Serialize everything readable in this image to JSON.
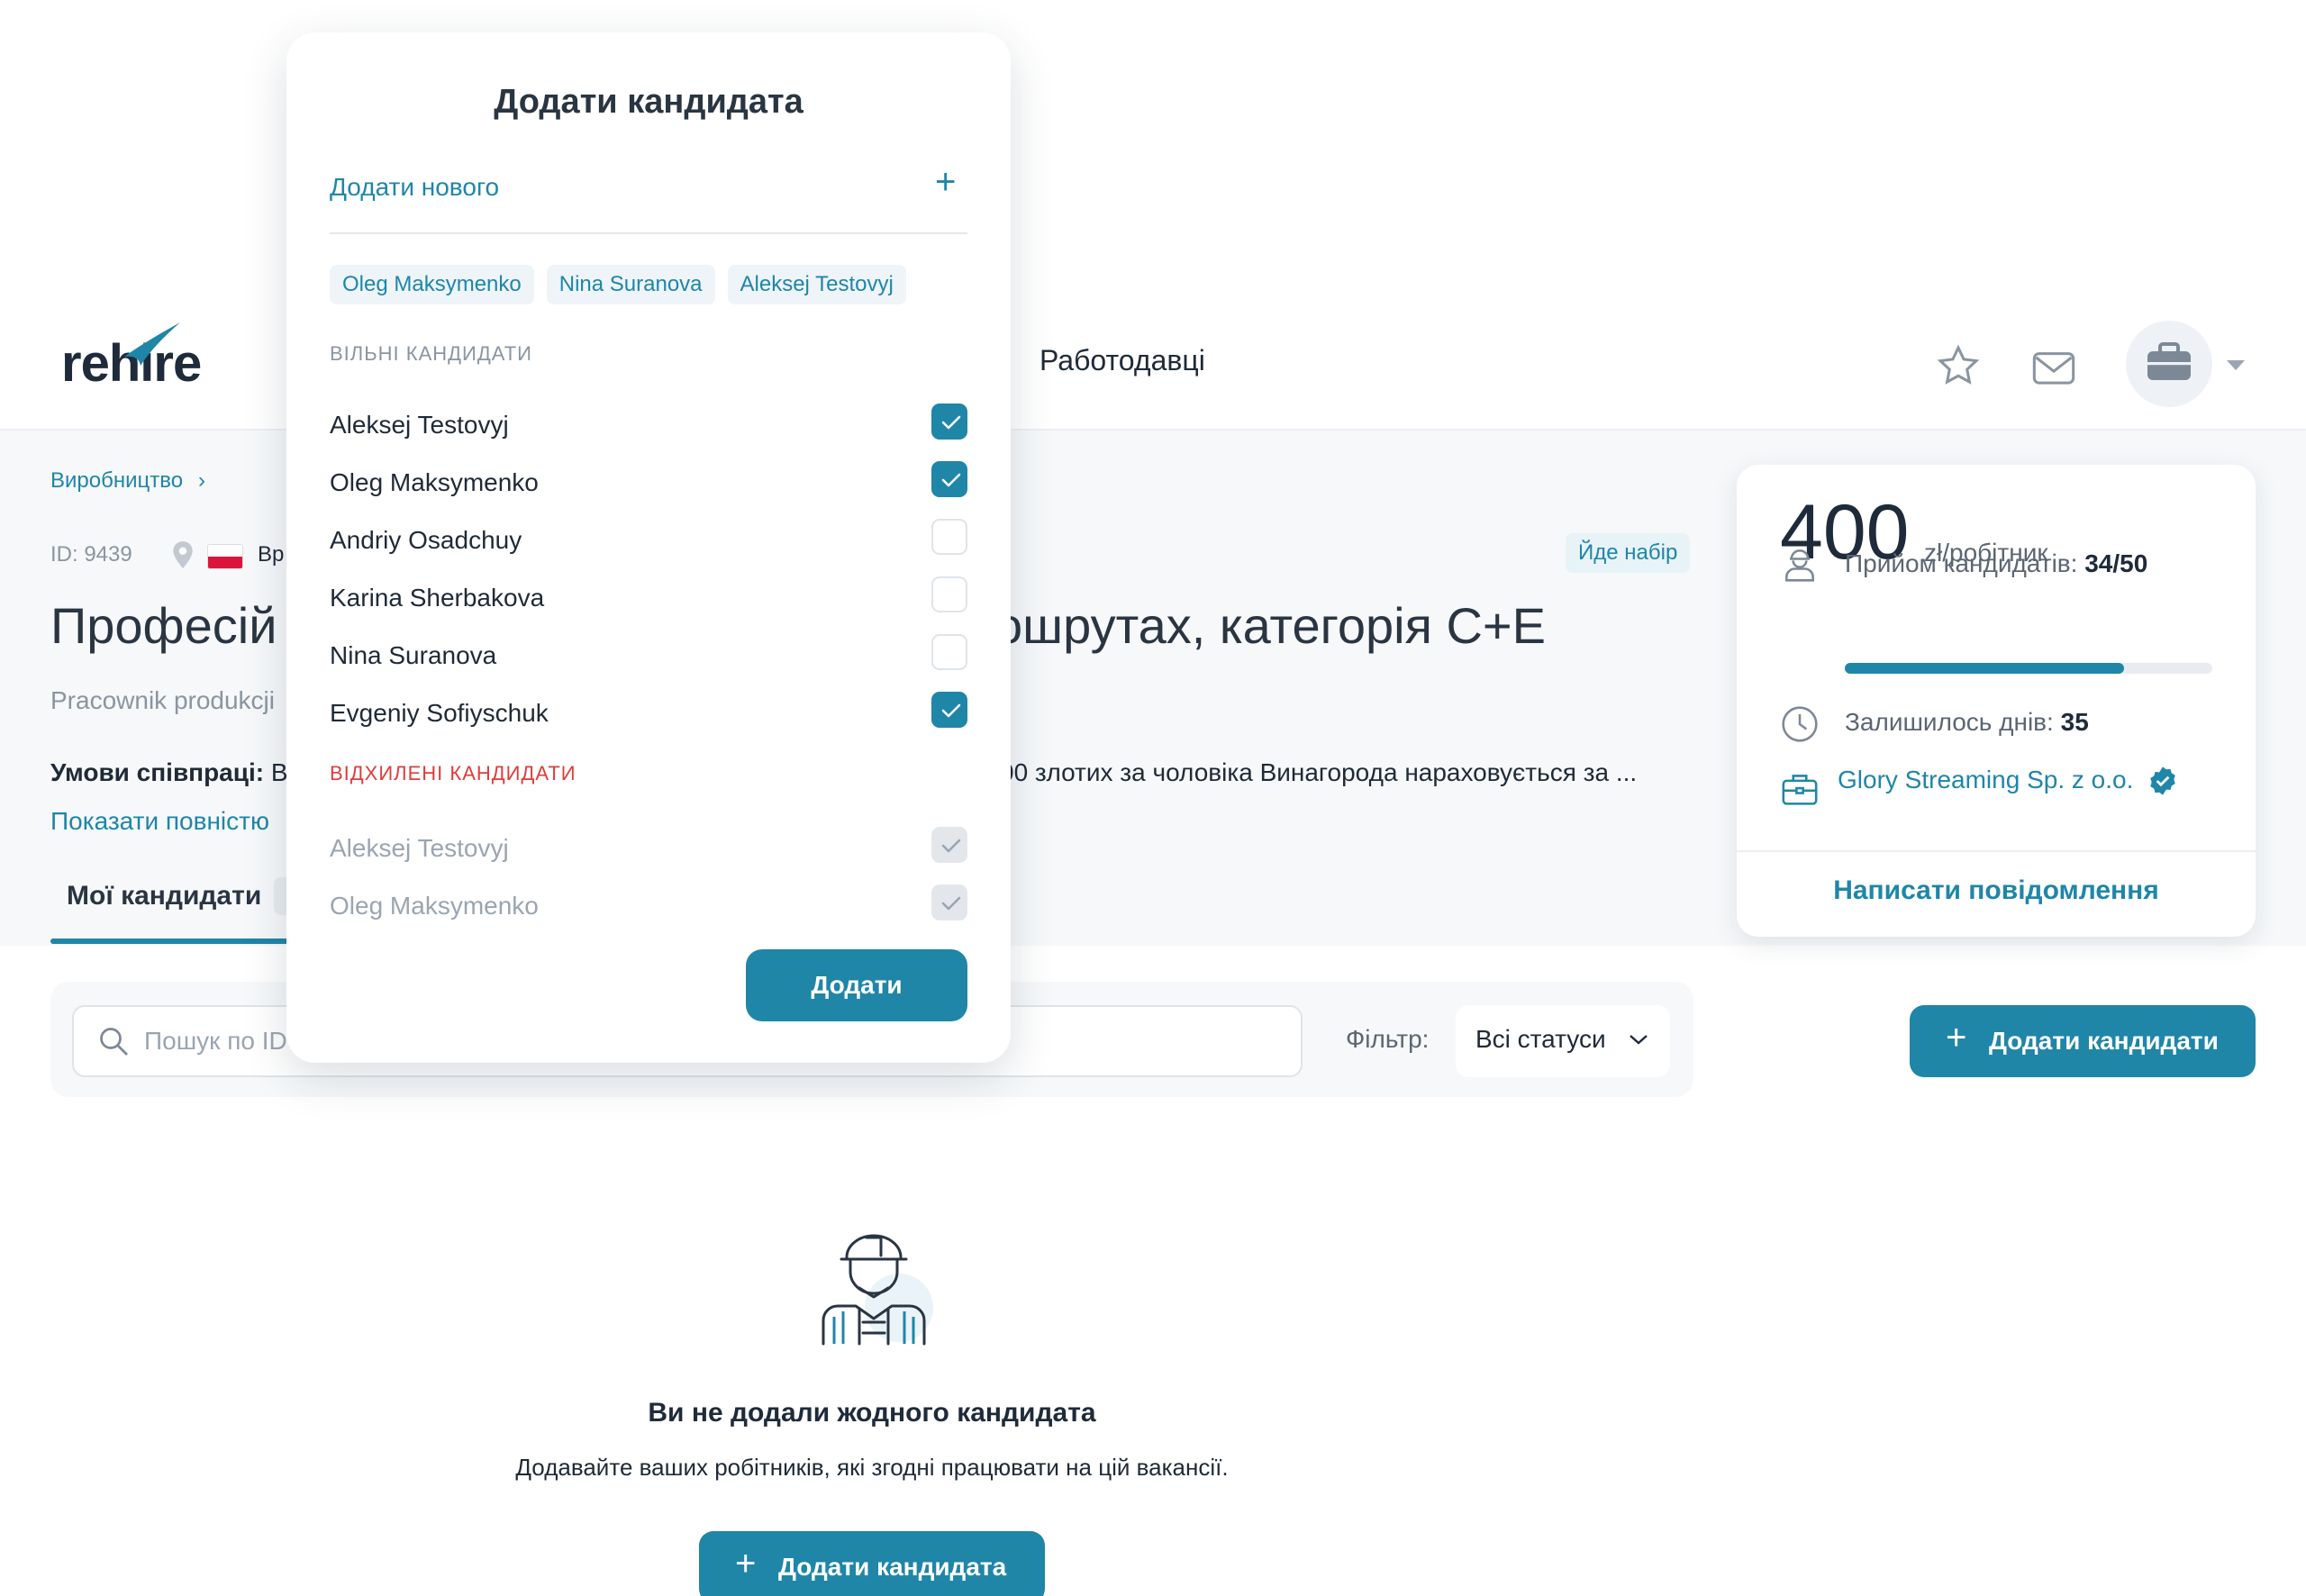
{
  "header": {
    "logo": "rehire",
    "nav_employers": "Работодавці"
  },
  "job": {
    "breadcrumb": "Виробництво",
    "id": "ID: 9439",
    "city": "Вр",
    "status": "Йде набір",
    "title_left": "Професій",
    "title_right": "ошрутах, категорія С+Е",
    "company_sub": "Pracownik produkcji",
    "terms_label": "Умови співпраці:",
    "terms_left": "Ви",
    "terms_right": "00 злотих за чоловіка Винагорода нараховується за  ...",
    "show_full": "Показати повністю",
    "tab_mine": "Мої кандидати"
  },
  "stats": {
    "price": "400",
    "price_unit": "zł/робітник",
    "intake_label": "Прийом кандидатів:",
    "intake_value": "34/50",
    "intake_fraction": 0.76,
    "days_label": "Залишилось днів:",
    "days_value": "35",
    "company": "Glory Streaming Sp. z o.o.",
    "write_message": "Написати повідомлення"
  },
  "toolbar": {
    "search_placeholder": "Пошук по ID",
    "filter_label": "Фільтр:",
    "filter_value": "Всі статуси",
    "add_candidates": "Додати кандидати"
  },
  "empty": {
    "title": "Ви не додали жодного кандидата",
    "subtitle": "Додавайте ваших робітників, які згодні працювати на цій вакансії.",
    "button": "Додати кандидата"
  },
  "modal": {
    "title": "Додати кандидата",
    "add_new": "Додати нового",
    "chips": [
      "Oleg Maksymenko",
      "Nina Suranova",
      "Aleksej Testovyj"
    ],
    "free_heading": "ВІЛЬНІ КАНДИДАТИ",
    "free": [
      {
        "name": "Aleksej Testovyj",
        "checked": true
      },
      {
        "name": "Oleg Maksymenko",
        "checked": true
      },
      {
        "name": "Andriy Osadchuy",
        "checked": false
      },
      {
        "name": "Karina Sherbakova",
        "checked": false
      },
      {
        "name": "Nina Suranova",
        "checked": false
      },
      {
        "name": "Evgeniy Sofiyschuk",
        "checked": true
      }
    ],
    "rejected_heading": "ВІДХИЛЕНІ КАНДИДАТИ",
    "rejected": [
      {
        "name": "Aleksej Testovyj"
      },
      {
        "name": "Oleg Maksymenko"
      }
    ],
    "submit": "Додати"
  },
  "colors": {
    "accent": "#1f86a8",
    "danger": "#e23b3b",
    "text": "#1f2a37"
  }
}
